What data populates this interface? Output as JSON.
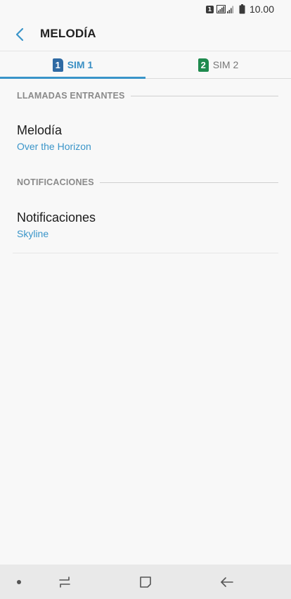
{
  "status_bar": {
    "sim_indicator": "1",
    "time": "10.00",
    "icons": [
      "sim-1-icon",
      "signal-sim1-icon",
      "signal-sim2-icon",
      "battery-icon"
    ]
  },
  "header": {
    "title": "MELODÍA",
    "back_icon": "chevron-left-icon"
  },
  "tabs": [
    {
      "number": "1",
      "label": "SIM 1",
      "active": true,
      "color": "#2f6aa3"
    },
    {
      "number": "2",
      "label": "SIM 2",
      "active": false,
      "color": "#1f8a4e"
    }
  ],
  "sections": [
    {
      "header": "LLAMADAS ENTRANTES",
      "item": {
        "title": "Melodía",
        "value": "Over the Horizon"
      }
    },
    {
      "header": "NOTIFICACIONES",
      "item": {
        "title": "Notificaciones",
        "value": "Skyline"
      }
    }
  ],
  "nav_bar": {
    "icons": [
      "dot-icon",
      "recents-icon",
      "home-icon",
      "back-arrow-icon"
    ]
  },
  "colors": {
    "accent": "#3a95c9",
    "background": "#f8f8f8",
    "nav_background": "#e9e9e9"
  }
}
